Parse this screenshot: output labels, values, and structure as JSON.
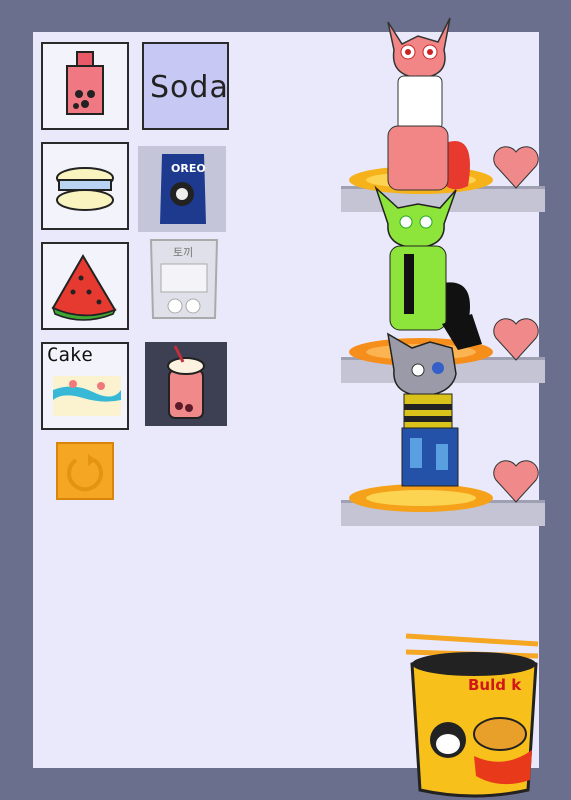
{
  "menu": {
    "soda_label": "Soda",
    "cake_label": "Cake",
    "oreo_brand": "OREO",
    "rabbit_pack_label": "토끼"
  },
  "noodle_cup": {
    "label": "Buld k"
  },
  "colors": {
    "background": "#6a6f8e",
    "panel": "#e9e9fb",
    "heart": "#f08a8a",
    "refresh": "#f5a623",
    "shelf": "#c4c4d4"
  },
  "icons": [
    "popsicle-icon",
    "soda-card",
    "macaron-icon",
    "oreo-pack",
    "watermelon-icon",
    "rabbit-snack-pack",
    "cake-card",
    "strawberry-drink",
    "refresh-icon",
    "heart-icon",
    "noodle-cup"
  ]
}
